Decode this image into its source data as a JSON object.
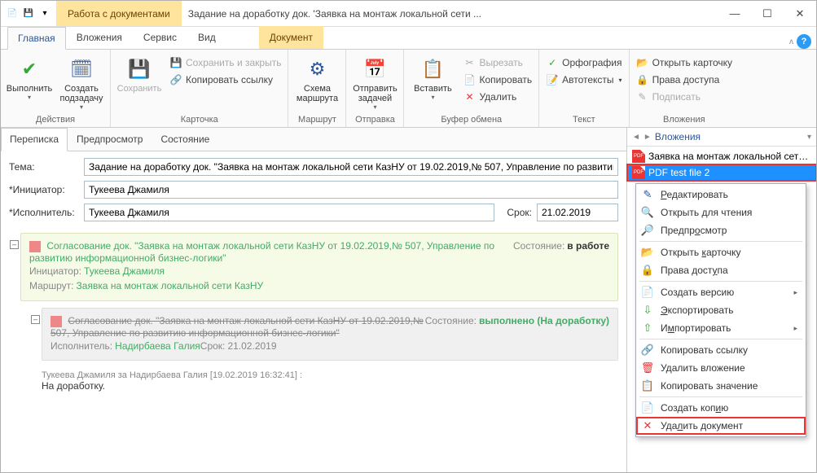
{
  "titlebar": {
    "context_tab": "Работа с документами",
    "window_title": "Задание на доработку док. 'Заявка на монтаж локальной сети ..."
  },
  "ribbon_tabs": {
    "items": [
      "Главная",
      "Вложения",
      "Сервис",
      "Вид"
    ],
    "doc_tab": "Документ"
  },
  "ribbon": {
    "exec": {
      "execute": "Выполнить",
      "subtask": "Создать подзадачу",
      "group": "Действия"
    },
    "save": {
      "save": "Сохранить",
      "save_close": "Сохранить и закрыть",
      "copy_link": "Копировать ссылку",
      "group": "Карточка"
    },
    "route": {
      "scheme": "Схема маршрута",
      "group": "Маршрут"
    },
    "send": {
      "send": "Отправить задачей",
      "group": "Отправка"
    },
    "paste": {
      "paste": "Вставить",
      "cut": "Вырезать",
      "copy": "Копировать",
      "delete": "Удалить",
      "group": "Буфер обмена"
    },
    "text": {
      "spell": "Орфография",
      "autotext": "Автотексты",
      "group": "Текст"
    },
    "attach": {
      "open_card": "Открыть карточку",
      "rights": "Права доступа",
      "sign": "Подписать",
      "group": "Вложения"
    }
  },
  "main_tabs": [
    "Переписка",
    "Предпросмотр",
    "Состояние"
  ],
  "form": {
    "subject_label": "Тема:",
    "subject_value": "Задание на доработку док. \"Заявка на монтаж локальной сети КазНУ от 19.02.2019,№ 507, Управление по развитию",
    "initiator_label": "Инициатор:",
    "initiator_value": "Тукеева Джамиля",
    "executor_label": "Исполнитель:",
    "executor_value": "Тукеева Джамиля",
    "deadline_label": "Срок:",
    "deadline_value": "21.02.2019"
  },
  "thread": {
    "item1": {
      "title": "Согласование док. \"Заявка на монтаж локальной сети КазНУ от 19.02.2019,№ 507, Управление по развитию информационной бизнес-логики\"",
      "initiator_k": "Инициатор:",
      "initiator_v": "Тукеева Джамиля",
      "route_k": "Маршрут:",
      "route_v": "Заявка на монтаж локальной сети КазНУ",
      "state_k": "Состояние:",
      "state_v": "в работе"
    },
    "item2": {
      "title": "Согласование док. \"Заявка на монтаж локальной сети КазНУ от 19.02.2019,№ 507, Управление по развитию информационной бизнес-логики\"",
      "executor_k": "Исполнитель:",
      "executor_v": "Надирбаева Галия",
      "deadline_k": "Срок:",
      "deadline_v": "21.02.2019",
      "state_k": "Состояние:",
      "state_v": "выполнено (На доработку)"
    },
    "msg": {
      "author": "Тукеева Джамиля за Надирбаева Галия [19.02.2019 16:32:41] :",
      "body": "На доработку."
    }
  },
  "side": {
    "title": "Вложения",
    "att1": "Заявка на монтаж локальной сети КазНУ о...",
    "att2": "PDF test file 2"
  },
  "ctx": {
    "edit": "Редактировать",
    "open_read": "Открыть для чтения",
    "preview": "Предпросмотр",
    "open_card": "Открыть карточку",
    "rights": "Права доступа",
    "version": "Создать версию",
    "export": "Экспортировать",
    "import": "Импортировать",
    "copy_link": "Копировать ссылку",
    "del_attach": "Удалить вложение",
    "copy_val": "Копировать значение",
    "make_copy": "Создать копию",
    "del_doc": "Удалить документ"
  }
}
